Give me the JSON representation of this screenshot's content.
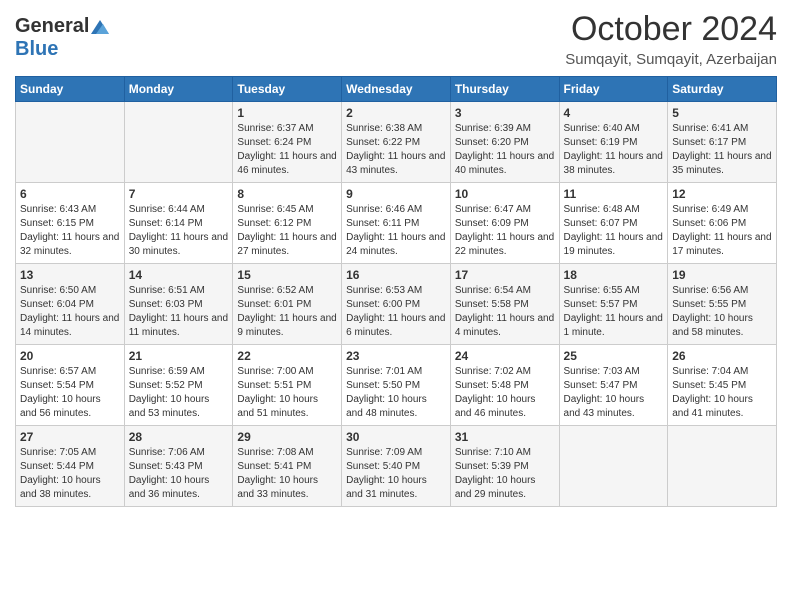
{
  "header": {
    "logo_general": "General",
    "logo_blue": "Blue",
    "month": "October 2024",
    "location": "Sumqayit, Sumqayit, Azerbaijan"
  },
  "days_of_week": [
    "Sunday",
    "Monday",
    "Tuesday",
    "Wednesday",
    "Thursday",
    "Friday",
    "Saturday"
  ],
  "weeks": [
    [
      {
        "day": "",
        "content": ""
      },
      {
        "day": "",
        "content": ""
      },
      {
        "day": "1",
        "content": "Sunrise: 6:37 AM\nSunset: 6:24 PM\nDaylight: 11 hours and 46 minutes."
      },
      {
        "day": "2",
        "content": "Sunrise: 6:38 AM\nSunset: 6:22 PM\nDaylight: 11 hours and 43 minutes."
      },
      {
        "day": "3",
        "content": "Sunrise: 6:39 AM\nSunset: 6:20 PM\nDaylight: 11 hours and 40 minutes."
      },
      {
        "day": "4",
        "content": "Sunrise: 6:40 AM\nSunset: 6:19 PM\nDaylight: 11 hours and 38 minutes."
      },
      {
        "day": "5",
        "content": "Sunrise: 6:41 AM\nSunset: 6:17 PM\nDaylight: 11 hours and 35 minutes."
      }
    ],
    [
      {
        "day": "6",
        "content": "Sunrise: 6:43 AM\nSunset: 6:15 PM\nDaylight: 11 hours and 32 minutes."
      },
      {
        "day": "7",
        "content": "Sunrise: 6:44 AM\nSunset: 6:14 PM\nDaylight: 11 hours and 30 minutes."
      },
      {
        "day": "8",
        "content": "Sunrise: 6:45 AM\nSunset: 6:12 PM\nDaylight: 11 hours and 27 minutes."
      },
      {
        "day": "9",
        "content": "Sunrise: 6:46 AM\nSunset: 6:11 PM\nDaylight: 11 hours and 24 minutes."
      },
      {
        "day": "10",
        "content": "Sunrise: 6:47 AM\nSunset: 6:09 PM\nDaylight: 11 hours and 22 minutes."
      },
      {
        "day": "11",
        "content": "Sunrise: 6:48 AM\nSunset: 6:07 PM\nDaylight: 11 hours and 19 minutes."
      },
      {
        "day": "12",
        "content": "Sunrise: 6:49 AM\nSunset: 6:06 PM\nDaylight: 11 hours and 17 minutes."
      }
    ],
    [
      {
        "day": "13",
        "content": "Sunrise: 6:50 AM\nSunset: 6:04 PM\nDaylight: 11 hours and 14 minutes."
      },
      {
        "day": "14",
        "content": "Sunrise: 6:51 AM\nSunset: 6:03 PM\nDaylight: 11 hours and 11 minutes."
      },
      {
        "day": "15",
        "content": "Sunrise: 6:52 AM\nSunset: 6:01 PM\nDaylight: 11 hours and 9 minutes."
      },
      {
        "day": "16",
        "content": "Sunrise: 6:53 AM\nSunset: 6:00 PM\nDaylight: 11 hours and 6 minutes."
      },
      {
        "day": "17",
        "content": "Sunrise: 6:54 AM\nSunset: 5:58 PM\nDaylight: 11 hours and 4 minutes."
      },
      {
        "day": "18",
        "content": "Sunrise: 6:55 AM\nSunset: 5:57 PM\nDaylight: 11 hours and 1 minute."
      },
      {
        "day": "19",
        "content": "Sunrise: 6:56 AM\nSunset: 5:55 PM\nDaylight: 10 hours and 58 minutes."
      }
    ],
    [
      {
        "day": "20",
        "content": "Sunrise: 6:57 AM\nSunset: 5:54 PM\nDaylight: 10 hours and 56 minutes."
      },
      {
        "day": "21",
        "content": "Sunrise: 6:59 AM\nSunset: 5:52 PM\nDaylight: 10 hours and 53 minutes."
      },
      {
        "day": "22",
        "content": "Sunrise: 7:00 AM\nSunset: 5:51 PM\nDaylight: 10 hours and 51 minutes."
      },
      {
        "day": "23",
        "content": "Sunrise: 7:01 AM\nSunset: 5:50 PM\nDaylight: 10 hours and 48 minutes."
      },
      {
        "day": "24",
        "content": "Sunrise: 7:02 AM\nSunset: 5:48 PM\nDaylight: 10 hours and 46 minutes."
      },
      {
        "day": "25",
        "content": "Sunrise: 7:03 AM\nSunset: 5:47 PM\nDaylight: 10 hours and 43 minutes."
      },
      {
        "day": "26",
        "content": "Sunrise: 7:04 AM\nSunset: 5:45 PM\nDaylight: 10 hours and 41 minutes."
      }
    ],
    [
      {
        "day": "27",
        "content": "Sunrise: 7:05 AM\nSunset: 5:44 PM\nDaylight: 10 hours and 38 minutes."
      },
      {
        "day": "28",
        "content": "Sunrise: 7:06 AM\nSunset: 5:43 PM\nDaylight: 10 hours and 36 minutes."
      },
      {
        "day": "29",
        "content": "Sunrise: 7:08 AM\nSunset: 5:41 PM\nDaylight: 10 hours and 33 minutes."
      },
      {
        "day": "30",
        "content": "Sunrise: 7:09 AM\nSunset: 5:40 PM\nDaylight: 10 hours and 31 minutes."
      },
      {
        "day": "31",
        "content": "Sunrise: 7:10 AM\nSunset: 5:39 PM\nDaylight: 10 hours and 29 minutes."
      },
      {
        "day": "",
        "content": ""
      },
      {
        "day": "",
        "content": ""
      }
    ]
  ]
}
